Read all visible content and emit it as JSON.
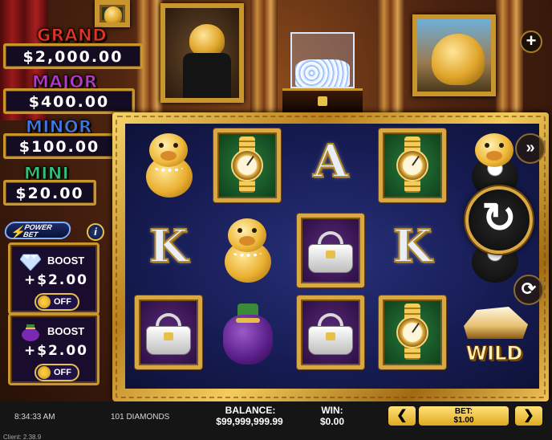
{
  "jackpots": [
    {
      "name": "GRAND",
      "value": "$2,000.00",
      "color": "#e0342a"
    },
    {
      "name": "MAJOR",
      "value": "$400.00",
      "color": "#b33ad0"
    },
    {
      "name": "MINOR",
      "value": "$100.00",
      "color": "#3a7ae8"
    },
    {
      "name": "MINI",
      "value": "$20.00",
      "color": "#2fc27a"
    }
  ],
  "power_bet": {
    "badge": "POWER\nBET",
    "info_icon": "info-icon",
    "boosts": [
      {
        "icon": "diamond-icon",
        "label": "BOOST",
        "value": "+$2.00",
        "toggle": "OFF"
      },
      {
        "icon": "moneybag-icon",
        "label": "BOOST",
        "value": "+$2.00",
        "toggle": "OFF"
      }
    ]
  },
  "reels": {
    "grid": [
      [
        "pig-lady",
        "watch",
        "A",
        "watch",
        "pig-tux"
      ],
      [
        "K",
        "pig-lady",
        "handbag",
        "K",
        "pig-tux"
      ],
      [
        "handbag",
        "moneybag",
        "handbag",
        "watch",
        "wild"
      ]
    ],
    "letters": {
      "A": "A",
      "K": "K"
    },
    "wild_text": "WILD"
  },
  "controls": {
    "plus": "+",
    "spin": "↻",
    "speed_icon": "speed-icon",
    "autoplay_icon": "autoplay-icon"
  },
  "status_bar": {
    "time": "8:34:33 AM",
    "diamonds": "101 DIAMONDS",
    "balance_label": "BALANCE:",
    "balance_value": "$99,999,999.99",
    "win_label": "WIN:",
    "win_value": "$0.00",
    "bet_label": "BET:",
    "bet_value": "$1.00",
    "bet_prev": "❮",
    "bet_next": "❯",
    "client_version": "Client: 2.38.9"
  }
}
